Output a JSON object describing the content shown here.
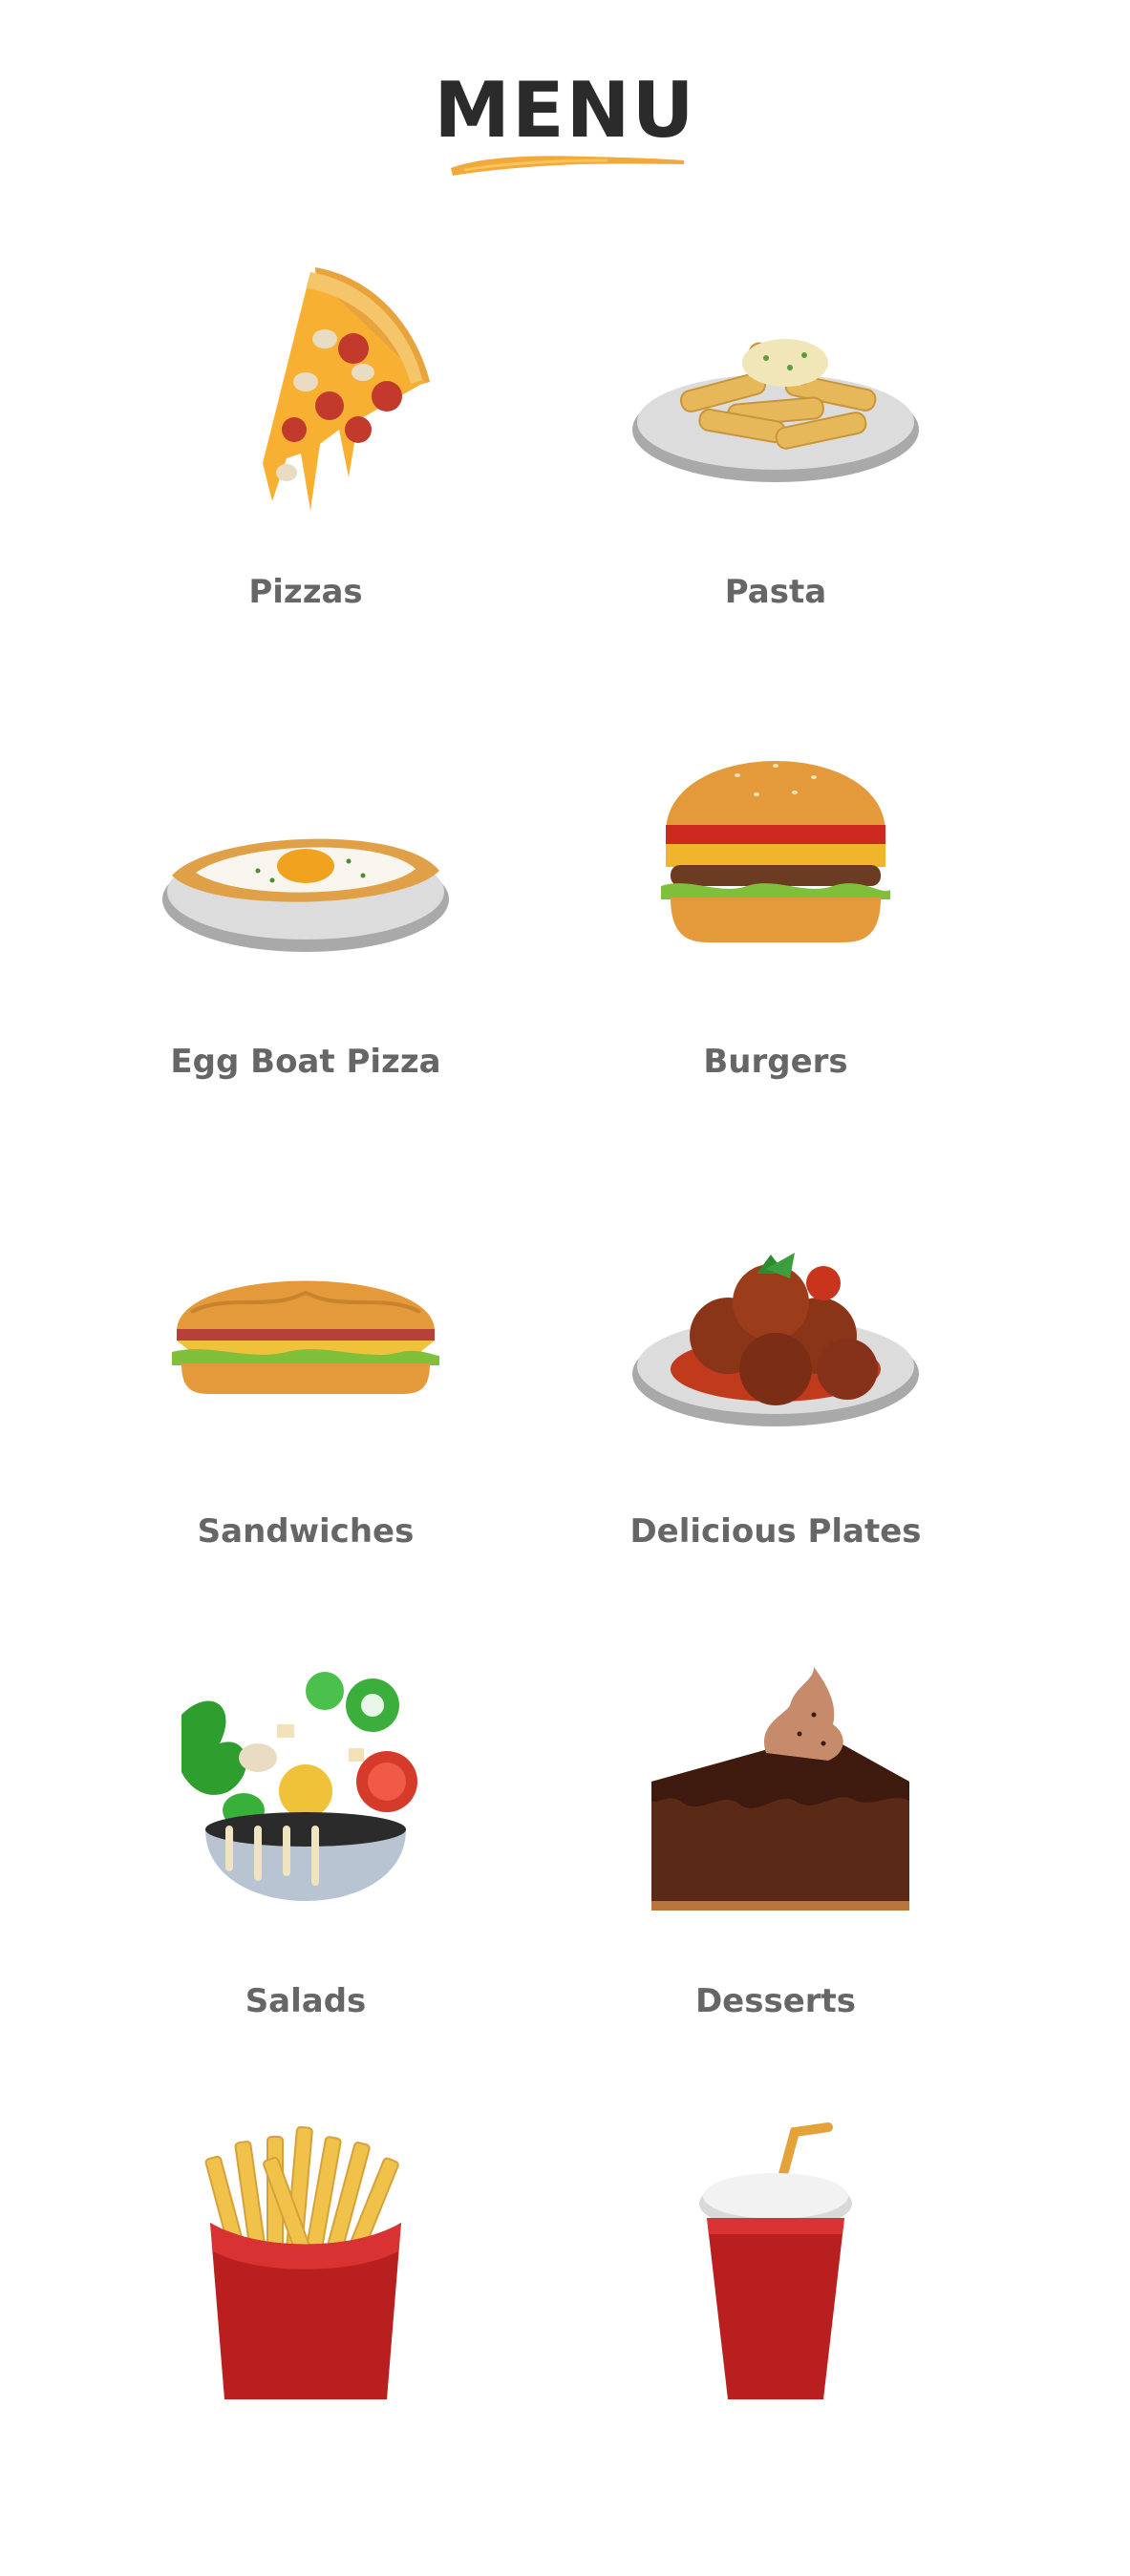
{
  "page": {
    "title": "MENU",
    "accent_color": "#f2a93b"
  },
  "menu": {
    "items": [
      {
        "label": "Pizzas",
        "icon": "pizza-slice-icon"
      },
      {
        "label": "Pasta",
        "icon": "pasta-plate-icon"
      },
      {
        "label": "Egg Boat Pizza",
        "icon": "egg-boat-pizza-icon"
      },
      {
        "label": "Burgers",
        "icon": "burger-icon"
      },
      {
        "label": "Sandwiches",
        "icon": "sandwich-icon"
      },
      {
        "label": "Delicious Plates",
        "icon": "meatballs-plate-icon"
      },
      {
        "label": "Salads",
        "icon": "salad-bowl-icon"
      },
      {
        "label": "Desserts",
        "icon": "chocolate-cake-icon"
      },
      {
        "label": "",
        "icon": "french-fries-icon"
      },
      {
        "label": "",
        "icon": "drink-cup-icon"
      }
    ]
  }
}
